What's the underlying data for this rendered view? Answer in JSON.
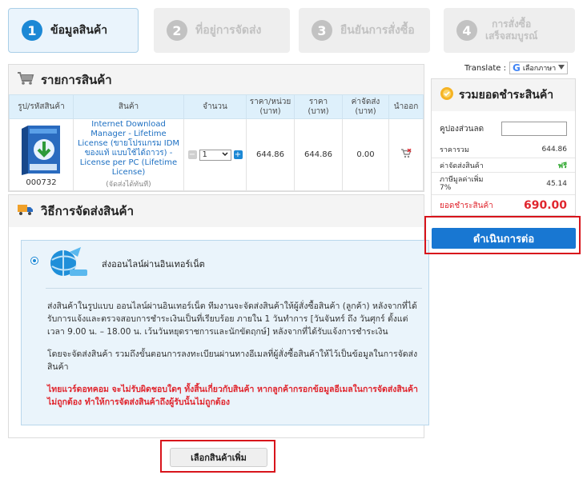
{
  "steps": [
    {
      "num": "1",
      "label": "ข้อมูลสินค้า",
      "label2": ""
    },
    {
      "num": "2",
      "label": "ที่อยู่การจัดส่ง",
      "label2": ""
    },
    {
      "num": "3",
      "label": "ยืนยันการสั่งซื้อ",
      "label2": ""
    },
    {
      "num": "4",
      "label": "การสั่งซื้อ",
      "label2": "เสร็จสมบูรณ์"
    }
  ],
  "cart": {
    "title": "รายการสินค้า",
    "headers": [
      "รูป/รหัสสินค้า",
      "สินค้า",
      "จำนวน",
      "ราคา/หน่วย",
      "(บาท)",
      "ราคา",
      "(บาท)",
      "ค่าจัดส่ง",
      "(บาท)",
      "นำออก"
    ],
    "item": {
      "code": "000732",
      "name": "Internet Download Manager - Lifetime License (ขายโปรแกรม IDM ของแท้ แบบใช้ได้ถาวร) - License per PC (Lifetime License)",
      "note": "(จัดส่งได้ทันที)",
      "qty": "1",
      "minus": "−",
      "plus": "+",
      "unit_price": "644.86",
      "price": "644.86",
      "shipping": "0.00"
    }
  },
  "shipping": {
    "title": "วิธีการจัดส่งสินค้า",
    "method": "ส่งออนไลน์ผ่านอินเทอร์เน็ต",
    "para1": "ส่งสินค้าในรูปแบบ ออนไลน์ผ่านอินเทอร์เน็ต ทีมงานจะจัดส่งสินค้าให้ผู้สั่งซื้อสินค้า (ลูกค้า) หลังจากที่ได้รับการแจ้งและตรวจสอบการชำระเงินเป็นที่เรียบร้อย ภายใน 1 วันทำการ [วันจันทร์ ถึง วันศุกร์ ตั้งแต่เวลา 9.00 น. – 18.00 น. เว้นวันหยุดราชการและนักขัตฤกษ์] หลังจากที่ได้รับแจ้งการชำระเงิน",
    "para2": "โดยจะจัดส่งสินค้า รวมถึงขั้นตอนการลงทะเบียนผ่านทางอีเมลที่ผู้สั่งซื้อสินค้าให้ไว้เป็นข้อมูลในการจัดส่งสินค้า",
    "warning": "ไทยแวร์ดอทคอม จะไม่รับผิดชอบใดๆ ทั้งสิ้นเกี่ยวกับสินค้า หากลูกค้ากรอกข้อมูลอีเมลในการจัดส่งสินค้าไม่ถูกต้อง ทำให้การจัดส่งสินค้าถึงผู้รับนั้นไม่ถูกต้อง"
  },
  "more_button": "เลือกสินค้าเพิ่ม",
  "translate": {
    "label": "Translate :",
    "select": "เลือกภาษา"
  },
  "summary": {
    "title": "รวมยอดชำระสินค้า",
    "coupon_label": "คูปองส่วนลด",
    "rows": [
      {
        "label": "ราคารวม",
        "value": "644.86"
      },
      {
        "label": "ค่าจัดส่งสินค้า",
        "value": "ฟรี"
      },
      {
        "label": "ภาษีมูลค่าเพิ่ม 7%",
        "value": "45.14"
      }
    ],
    "total_label": "ยอดชำระสินค้า",
    "total_value": "690.00"
  },
  "continue_button": "ดำเนินการต่อ",
  "colors": {
    "accent": "#1877d2",
    "highlight": "#d8141b",
    "warning": "#e0262e"
  }
}
